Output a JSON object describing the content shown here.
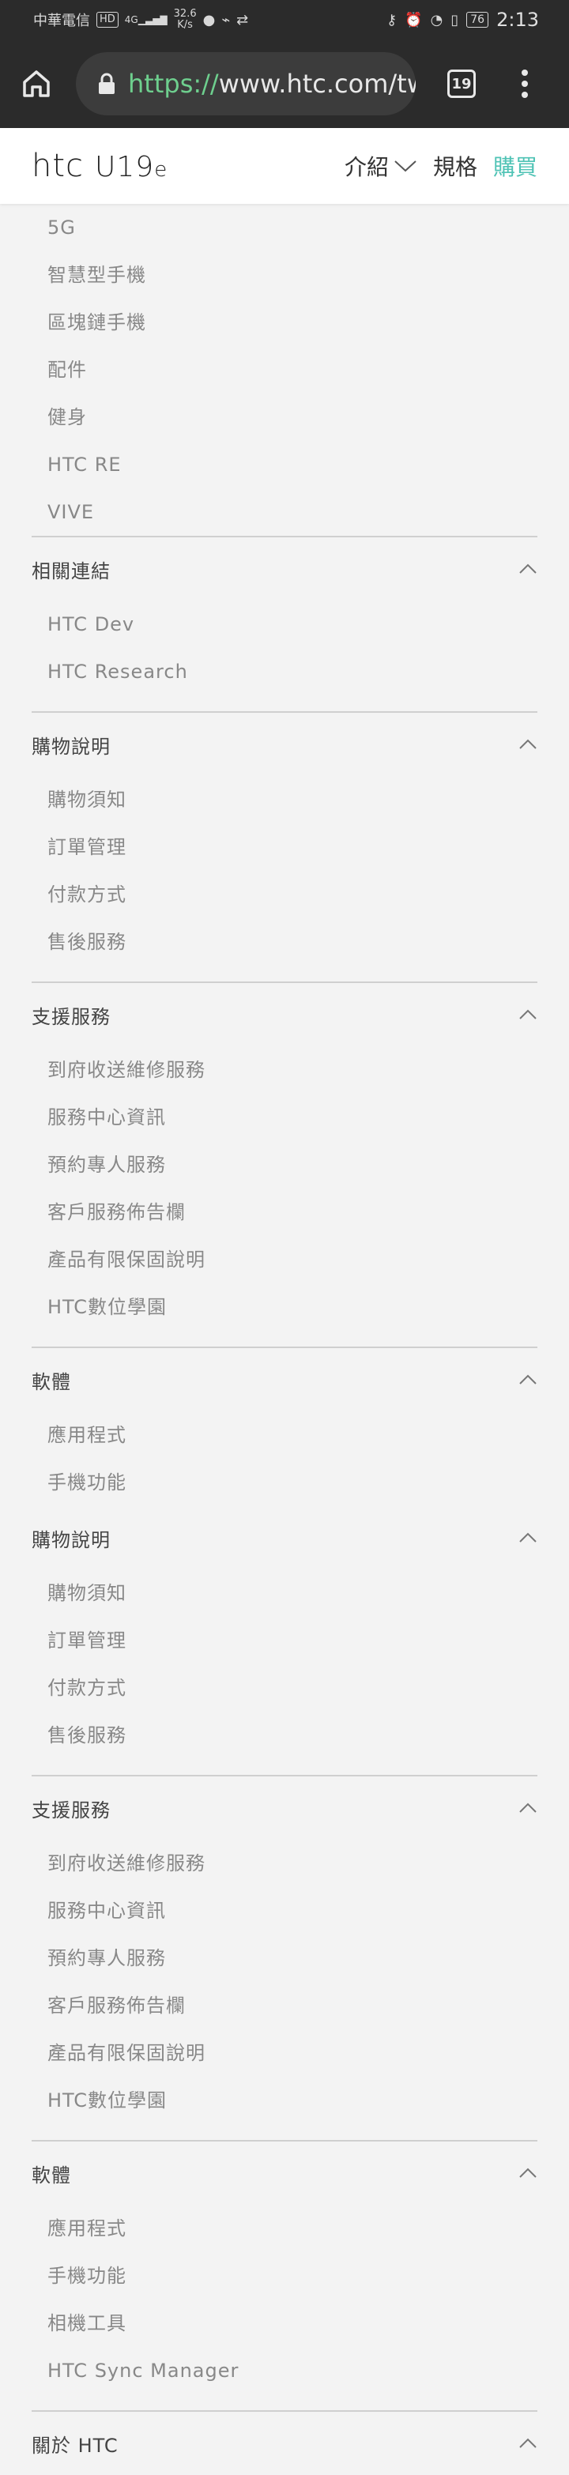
{
  "status": {
    "carrier": "中華電信",
    "hd": "HD",
    "signal": "4G",
    "speed_value": "32.6",
    "speed_unit": "K/s",
    "battery": "76",
    "time": "2:13"
  },
  "browser": {
    "url_scheme": "https://",
    "url_host": "www.htc.com/tw",
    "tab_count": "19"
  },
  "header": {
    "logo_brand": "htc",
    "logo_model": "U19",
    "logo_sub": "e",
    "nav_intro": "介紹",
    "nav_spec": "規格",
    "nav_buy": "購買"
  },
  "colors": {
    "accent": "#4fc3b5",
    "url_scheme": "#6ecf8e",
    "chrome": "#2b2b2b"
  },
  "menu": {
    "top_links": [
      "5G",
      "智慧型手機",
      "區塊鏈手機",
      "配件",
      "健身",
      "HTC RE",
      "VIVE"
    ],
    "sections": [
      {
        "title": "相關連結",
        "links": [
          "HTC Dev",
          "HTC Research"
        ],
        "divider": true
      },
      {
        "title": "購物說明",
        "links": [
          "購物須知",
          "訂單管理",
          "付款方式",
          "售後服務"
        ],
        "divider": true
      },
      {
        "title": "支援服務",
        "links": [
          "到府收送維修服務",
          "服務中心資訊",
          "預約專人服務",
          "客戶服務佈告欄",
          "產品有限保固說明",
          "HTC數位學園"
        ],
        "divider": true
      },
      {
        "title": "軟體",
        "links": [
          "應用程式",
          "手機功能"
        ],
        "divider": false
      },
      {
        "title": "購物說明",
        "links": [
          "購物須知",
          "訂單管理",
          "付款方式",
          "售後服務"
        ],
        "divider": true
      },
      {
        "title": "支援服務",
        "links": [
          "到府收送維修服務",
          "服務中心資訊",
          "預約專人服務",
          "客戶服務佈告欄",
          "產品有限保固說明",
          "HTC數位學園"
        ],
        "divider": true
      },
      {
        "title": "軟體",
        "links": [
          "應用程式",
          "手機功能",
          "相機工具",
          "HTC Sync Manager"
        ],
        "divider": true
      },
      {
        "title": "關於 HTC",
        "links": [],
        "divider": false
      }
    ]
  }
}
